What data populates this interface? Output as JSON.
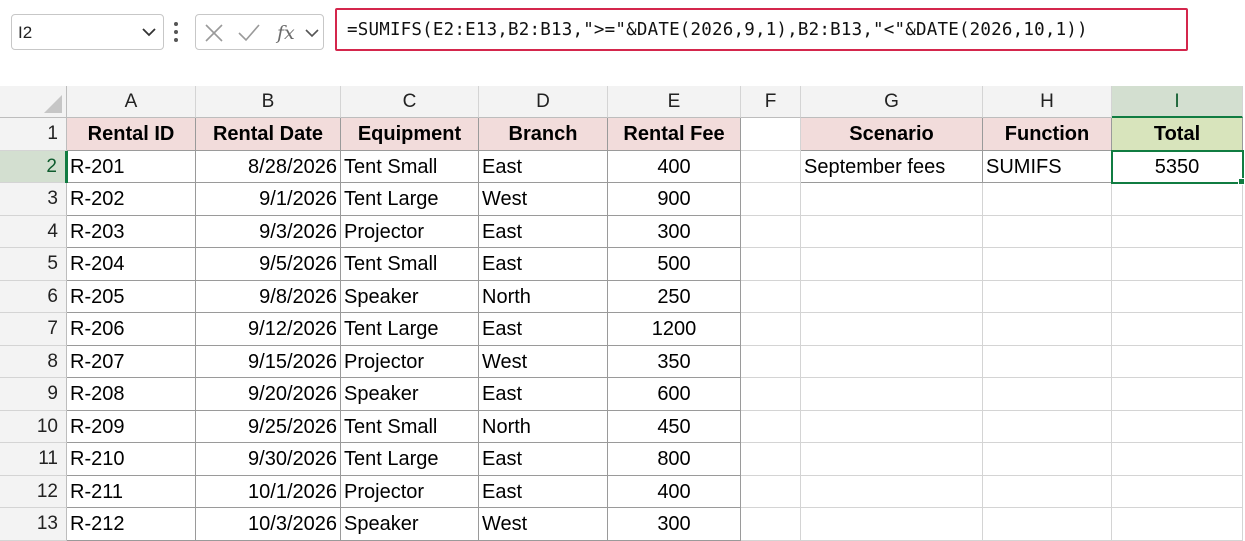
{
  "name_box": {
    "value": "I2"
  },
  "formula_bar": {
    "formula": "=SUMIFS(E2:E13,B2:B13,\">=\"&DATE(2026,9,1),B2:B13,\"<\"&DATE(2026,10,1))",
    "highlight_color": "#d4264c"
  },
  "columns": [
    "A",
    "B",
    "C",
    "D",
    "E",
    "F",
    "G",
    "H",
    "I"
  ],
  "rows": [
    "1",
    "2",
    "3",
    "4",
    "5",
    "6",
    "7",
    "8",
    "9",
    "10",
    "11",
    "12",
    "13"
  ],
  "selected_column": "I",
  "selected_row": "2",
  "table": {
    "headers": [
      "Rental ID",
      "Rental Date",
      "Equipment",
      "Branch",
      "Rental Fee"
    ],
    "rows": [
      [
        "R-201",
        "8/28/2026",
        "Tent Small",
        "East",
        "400"
      ],
      [
        "R-202",
        "9/1/2026",
        "Tent Large",
        "West",
        "900"
      ],
      [
        "R-203",
        "9/3/2026",
        "Projector",
        "East",
        "300"
      ],
      [
        "R-204",
        "9/5/2026",
        "Tent Small",
        "East",
        "500"
      ],
      [
        "R-205",
        "9/8/2026",
        "Speaker",
        "North",
        "250"
      ],
      [
        "R-206",
        "9/12/2026",
        "Tent Large",
        "East",
        "1200"
      ],
      [
        "R-207",
        "9/15/2026",
        "Projector",
        "West",
        "350"
      ],
      [
        "R-208",
        "9/20/2026",
        "Speaker",
        "East",
        "600"
      ],
      [
        "R-209",
        "9/25/2026",
        "Tent Small",
        "North",
        "450"
      ],
      [
        "R-210",
        "9/30/2026",
        "Tent Large",
        "East",
        "800"
      ],
      [
        "R-211",
        "10/1/2026",
        "Projector",
        "East",
        "400"
      ],
      [
        "R-212",
        "10/3/2026",
        "Speaker",
        "West",
        "300"
      ]
    ]
  },
  "summary": {
    "headers": [
      "Scenario",
      "Function",
      "Total"
    ],
    "rows": [
      [
        "September fees",
        "SUMIFS",
        "5350"
      ]
    ]
  },
  "colors": {
    "header_fill": "#f2dcdb",
    "total_header_fill": "#d8e4bc",
    "selection": "#107c41"
  },
  "icons": {
    "name_box_dropdown": "chevron-down-icon",
    "more": "vertical-dots-icon",
    "cancel": "x-icon",
    "enter": "checkmark-icon",
    "insert_function": "fx-icon",
    "expand": "chevron-down-icon"
  }
}
